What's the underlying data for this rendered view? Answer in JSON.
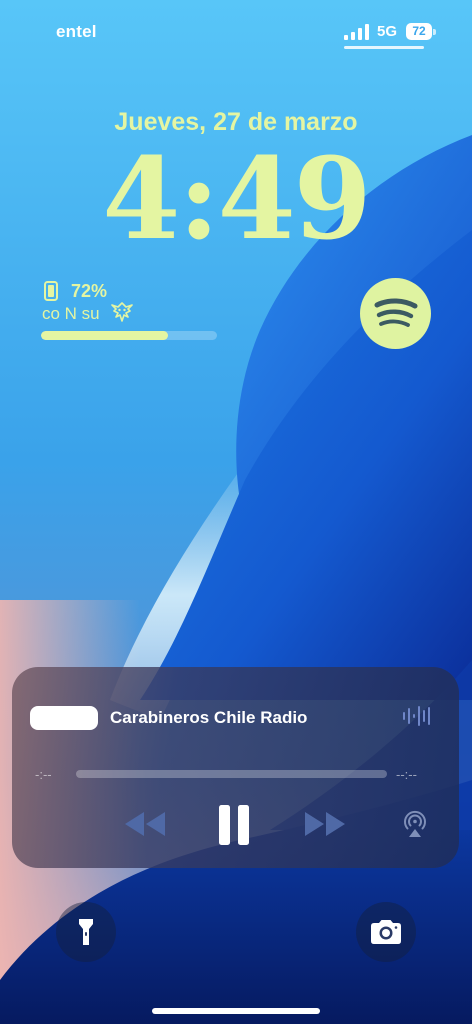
{
  "status_bar": {
    "carrier": "entel",
    "network": "5G",
    "battery_level": "72"
  },
  "lock_screen": {
    "date": "Jueves, 27 de marzo",
    "time": "4:49"
  },
  "battery_widget": {
    "percent": "72%",
    "device": "co N su",
    "level": 0.72,
    "icons": [
      "phone-icon",
      "dragon-icon"
    ]
  },
  "spotify_widget": {
    "icon": "spotify-icon"
  },
  "now_playing": {
    "station": "Carabineros Chile Radio",
    "elapsed": "-:--",
    "remaining": "--:--",
    "icons": [
      "waveform-icon",
      "rewind-icon",
      "pause-icon",
      "forward-icon",
      "airplay-icon"
    ]
  },
  "quick_actions": {
    "icons": [
      "flashlight-icon",
      "camera-icon"
    ]
  },
  "colors": {
    "accent": "#e4f5a2",
    "wallpaper_light": "#6fd0ff",
    "wallpaper_dark": "#0a2a8c"
  }
}
